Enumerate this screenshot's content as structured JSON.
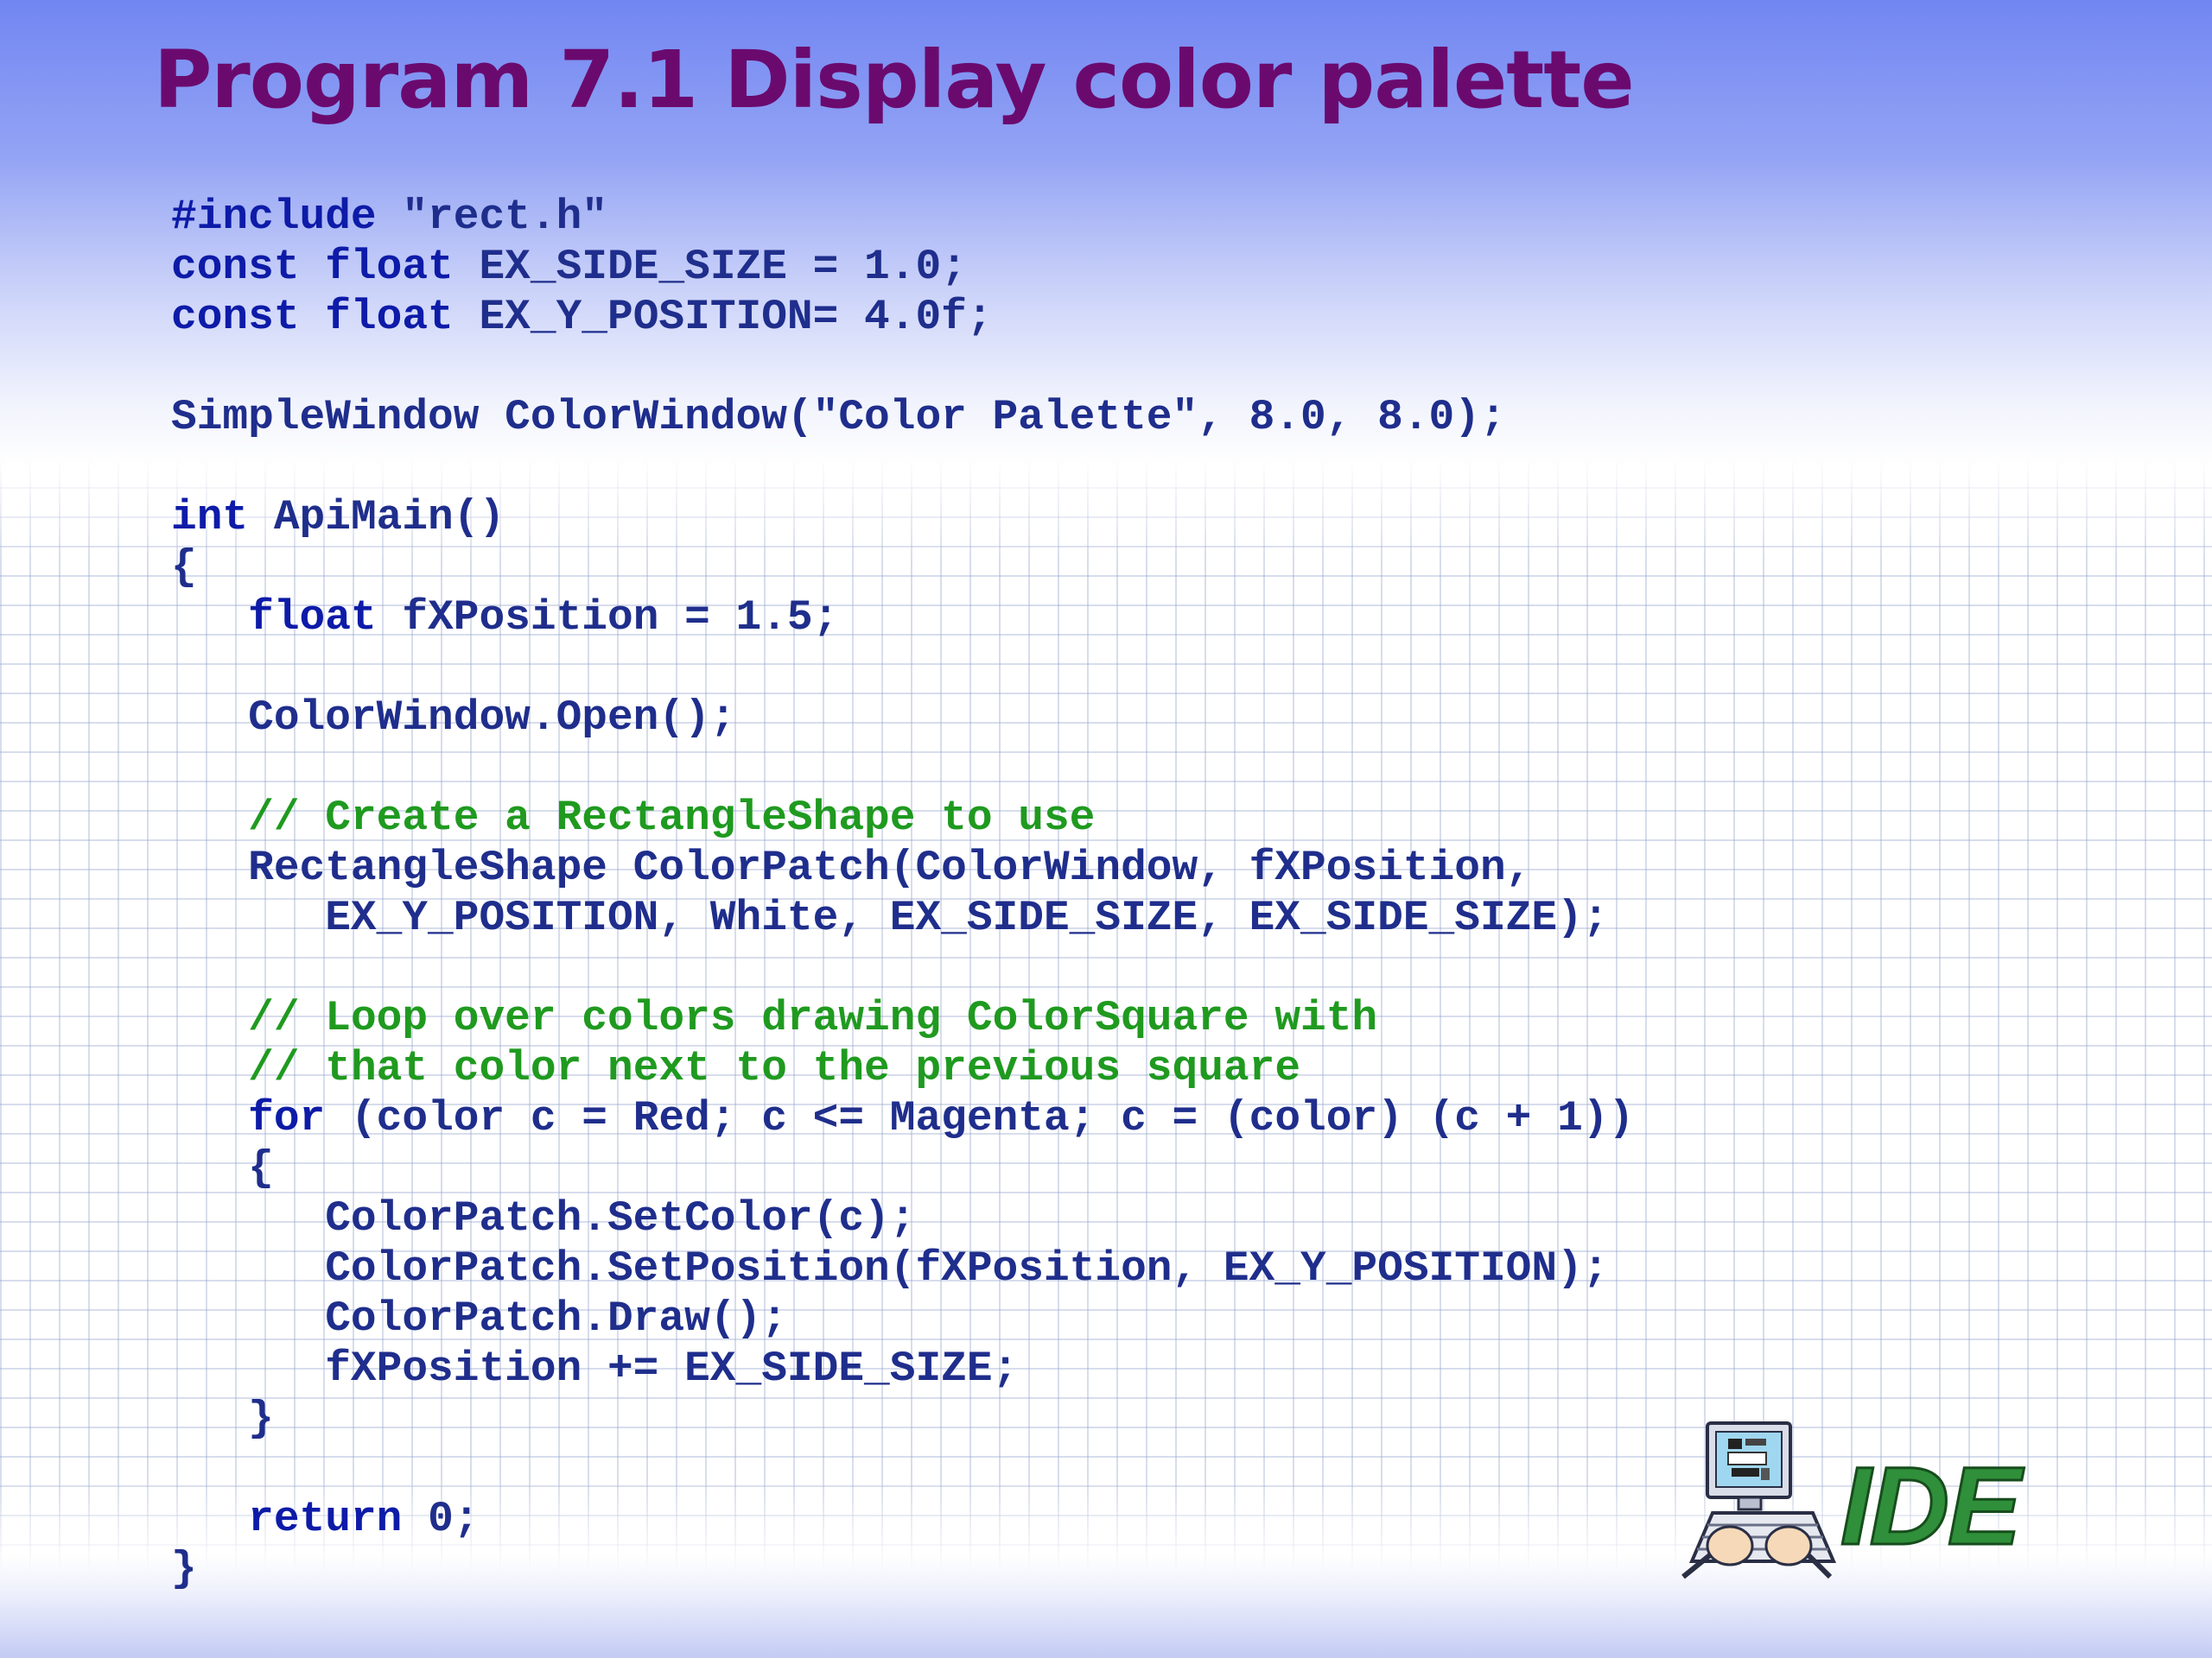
{
  "slide": {
    "title": "Program 7.1 Display color palette",
    "logo_text": "IDE"
  },
  "code": {
    "lines": [
      [
        {
          "t": "#include",
          "c": "kw"
        },
        {
          "t": " \"rect.h\"",
          "c": "tx"
        }
      ],
      [
        {
          "t": "const float",
          "c": "kw"
        },
        {
          "t": " EX_SIDE_SIZE = 1.0;",
          "c": "tx"
        }
      ],
      [
        {
          "t": "const float",
          "c": "kw"
        },
        {
          "t": " EX_Y_POSITION= 4.0f;",
          "c": "tx"
        }
      ],
      [],
      [
        {
          "t": "SimpleWindow ColorWindow(\"Color Palette\", 8.0, 8.0);",
          "c": "tx"
        }
      ],
      [],
      [
        {
          "t": "int",
          "c": "kw"
        },
        {
          "t": " ApiMain()",
          "c": "tx"
        }
      ],
      [
        {
          "t": "{",
          "c": "tx"
        }
      ],
      [
        {
          "t": "   ",
          "c": "tx"
        },
        {
          "t": "float",
          "c": "kw"
        },
        {
          "t": " fXPosition = 1.5;",
          "c": "tx"
        }
      ],
      [],
      [
        {
          "t": "   ColorWindow.Open();",
          "c": "tx"
        }
      ],
      [],
      [
        {
          "t": "   ",
          "c": "tx"
        },
        {
          "t": "// Create a RectangleShape to use",
          "c": "cm"
        }
      ],
      [
        {
          "t": "   RectangleShape ColorPatch(ColorWindow, fXPosition,",
          "c": "tx"
        }
      ],
      [
        {
          "t": "      EX_Y_POSITION, White, EX_SIDE_SIZE, EX_SIDE_SIZE);",
          "c": "tx"
        }
      ],
      [],
      [
        {
          "t": "   ",
          "c": "tx"
        },
        {
          "t": "// Loop over colors drawing ColorSquare with",
          "c": "cm"
        }
      ],
      [
        {
          "t": "   ",
          "c": "tx"
        },
        {
          "t": "// that color next to the previous square",
          "c": "cm"
        }
      ],
      [
        {
          "t": "   ",
          "c": "tx"
        },
        {
          "t": "for",
          "c": "kw"
        },
        {
          "t": " (color c = Red; c <= Magenta; c = (color) (c + 1))",
          "c": "tx"
        }
      ],
      [
        {
          "t": "   {",
          "c": "tx"
        }
      ],
      [
        {
          "t": "      ColorPatch.SetColor(c);",
          "c": "tx"
        }
      ],
      [
        {
          "t": "      ColorPatch.SetPosition(fXPosition, EX_Y_POSITION);",
          "c": "tx"
        }
      ],
      [
        {
          "t": "      ColorPatch.Draw();",
          "c": "tx"
        }
      ],
      [
        {
          "t": "      fXPosition += EX_SIDE_SIZE;",
          "c": "tx"
        }
      ],
      [
        {
          "t": "   }",
          "c": "tx"
        }
      ],
      [],
      [
        {
          "t": "   ",
          "c": "tx"
        },
        {
          "t": "return",
          "c": "kw"
        },
        {
          "t": " 0;",
          "c": "tx"
        }
      ],
      [
        {
          "t": "}",
          "c": "tx"
        }
      ]
    ]
  },
  "colors": {
    "title": "#6b0a6e",
    "code_text": "#1f2e8c",
    "keyword": "#0d1ba8",
    "comment": "#1f9a1f",
    "logo_green": "#2f8f3a"
  }
}
